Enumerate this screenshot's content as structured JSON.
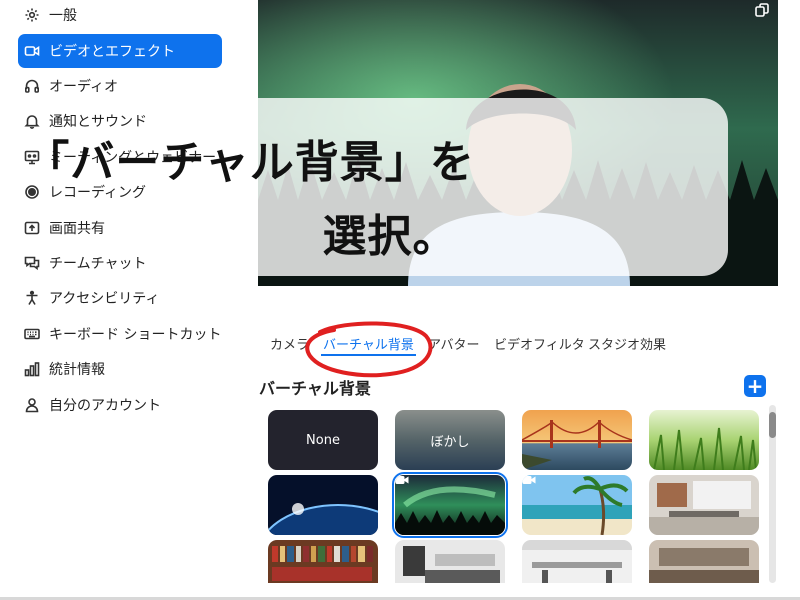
{
  "sidebar": {
    "items": [
      {
        "label": "一般",
        "icon": "gear-icon"
      },
      {
        "label": "ビデオとエフェクト",
        "icon": "video-icon",
        "active": true
      },
      {
        "label": "オーディオ",
        "icon": "headphones-icon"
      },
      {
        "label": "通知とサウンド",
        "icon": "bell-icon"
      },
      {
        "label": "ミーティングとウェビナー",
        "icon": "meeting-icon"
      },
      {
        "label": "レコーディング",
        "icon": "record-icon"
      },
      {
        "label": "画面共有",
        "icon": "share-screen-icon"
      },
      {
        "label": "チームチャット",
        "icon": "chat-icon"
      },
      {
        "label": "アクセシビリティ",
        "icon": "accessibility-icon"
      },
      {
        "label": "キーボード ショートカット",
        "icon": "keyboard-icon"
      },
      {
        "label": "統計情報",
        "icon": "statistics-icon"
      },
      {
        "label": "自分のアカウント",
        "icon": "account-icon"
      }
    ]
  },
  "caption": {
    "line1": "「バーチャル背景」を",
    "line2": "選択。"
  },
  "tabs": [
    {
      "label": "カメラ"
    },
    {
      "label": "バーチャル背景",
      "active": true
    },
    {
      "label": "アバター"
    },
    {
      "label": "ビデオフィルタ"
    },
    {
      "label": "スタジオ効果"
    }
  ],
  "section": {
    "title": "バーチャル背景",
    "add_label": "+"
  },
  "thumbnails": [
    {
      "label": "None"
    },
    {
      "label": "ぼかし"
    },
    {
      "label": ""
    },
    {
      "label": ""
    },
    {
      "label": ""
    },
    {
      "label": "",
      "selected": true
    },
    {
      "label": ""
    },
    {
      "label": ""
    },
    {
      "label": ""
    },
    {
      "label": ""
    },
    {
      "label": ""
    },
    {
      "label": ""
    }
  ],
  "colors": {
    "accent": "#0e72ed",
    "annotation": "#e02020"
  }
}
